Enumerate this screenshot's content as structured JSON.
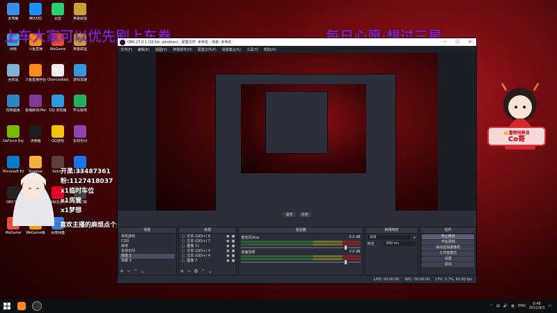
{
  "desktop": {
    "icons": [
      {
        "label": "此电脑",
        "color": "#3a8ee6"
      },
      {
        "label": "腾讯QQ",
        "color": "#1e90ff"
      },
      {
        "label": "迅雷",
        "color": "#2ecc71"
      },
      {
        "label": "英雄联盟",
        "color": "#c9a33a"
      },
      {
        "label": "网络",
        "color": "#4aa3df"
      },
      {
        "label": "斗鱼直播",
        "color": "#ff8c1a"
      },
      {
        "label": "WeGame",
        "color": "#e74c3c"
      },
      {
        "label": "英雄联盟",
        "color": "#c9a33a"
      },
      {
        "label": "回收站",
        "color": "#7fb3d5"
      },
      {
        "label": "斗鱼直播伴侣",
        "color": "#ff8c1a"
      },
      {
        "label": "Overcooked",
        "color": "#eeeeee"
      },
      {
        "label": "游戏加速",
        "color": "#3498db"
      },
      {
        "label": "控制面板",
        "color": "#2e86c1"
      },
      {
        "label": "雀魂麻将(Mahjong...)",
        "color": "#7d3c98"
      },
      {
        "label": "QQ 浏览器",
        "color": "#3498db"
      },
      {
        "label": "学以致用",
        "color": "#27ae60"
      },
      {
        "label": "GeForce Experience",
        "color": "#76b900"
      },
      {
        "label": "决赛圈",
        "color": "#1c1c1c"
      },
      {
        "label": "QQ游戏",
        "color": "#f1c40f"
      },
      {
        "label": "永劫无间",
        "color": "#8e44ad"
      },
      {
        "label": "Microsoft Edge",
        "color": "#0c7ac8"
      },
      {
        "label": "Shadow",
        "color": "#f5b041"
      },
      {
        "label": "Sekiro",
        "color": "#5d4037"
      },
      {
        "label": "酷狗",
        "color": "#1a73e8"
      },
      {
        "label": "OBS S...",
        "color": "#222222"
      },
      {
        "label": "Steam",
        "color": "#1b2838"
      },
      {
        "label": "网易云音乐",
        "color": "#e60026"
      },
      {
        "label": "恐怖之眼",
        "color": "#444444"
      },
      {
        "label": "WeGame",
        "color": "#e74c3c"
      },
      {
        "label": "WeGame版",
        "color": "#f39c12"
      },
      {
        "label": "百度网盘",
        "color": "#3b7ddd"
      }
    ]
  },
  "overlay": {
    "headline_left": "上车大家可以优先刷上车卷",
    "headline_right": "每日心愿:想过三星",
    "stats": [
      "开黑:33487361",
      "粉:1127418037",
      "x1临时车位",
      "x1房管",
      "x1梦想"
    ],
    "follow_text": "喜欢主播的麻烦点个关注",
    "badge_top": "👑富榜饲养员",
    "badge_name": "Co哥"
  },
  "obs": {
    "window_title": "OBS 27.0.1 (32-bit, windows) - 配置文件: 未命名 - 场景: 未命名",
    "menu": [
      "文件(F)",
      "编辑(E)",
      "视图(V)",
      "停靠部件(D)",
      "配置文件(P)",
      "场景集合(S)",
      "工具(T)",
      "帮助(H)"
    ],
    "scene_toolbar": [
      "属性",
      "滤镜"
    ],
    "docks": {
      "scenes": {
        "title": "场景",
        "items": [
          "单机游戏",
          "COD",
          "麻将",
          "永劫无间",
          "场景 2",
          "场景 3"
        ],
        "selected_index": 4
      },
      "sources": {
        "title": "来源",
        "items": [
          "文本 (GDI+) 6",
          "文本 (GDI+) 7",
          "图像 11",
          "文本 (GDI+) 5",
          "文本 (GDI+) 4",
          "图像 7"
        ]
      },
      "mixer": {
        "title": "混音器",
        "channels": [
          {
            "name": "麦克风/Aux",
            "db": "0.0 dB"
          },
          {
            "name": "桌面音频",
            "db": "0.0 dB"
          }
        ]
      },
      "transitions": {
        "title": "转场特效",
        "type": "淡出",
        "duration_label": "时长",
        "duration_value": "300 ms"
      },
      "controls": {
        "title": "控件",
        "buttons": [
          "停止推流",
          "开始录制",
          "启动虚拟摄像机",
          "工作室模式",
          "设置",
          "退出"
        ]
      }
    },
    "status": {
      "live": "LIVE: 00:00:00",
      "rec": "REC: 00:00:00",
      "cpu": "CPU: 0.7%, 60.00 fps"
    }
  },
  "taskbar": {
    "tray_ime": "英",
    "tray_lang": "ENG",
    "time": "0:48",
    "date": "2021/9/3"
  }
}
